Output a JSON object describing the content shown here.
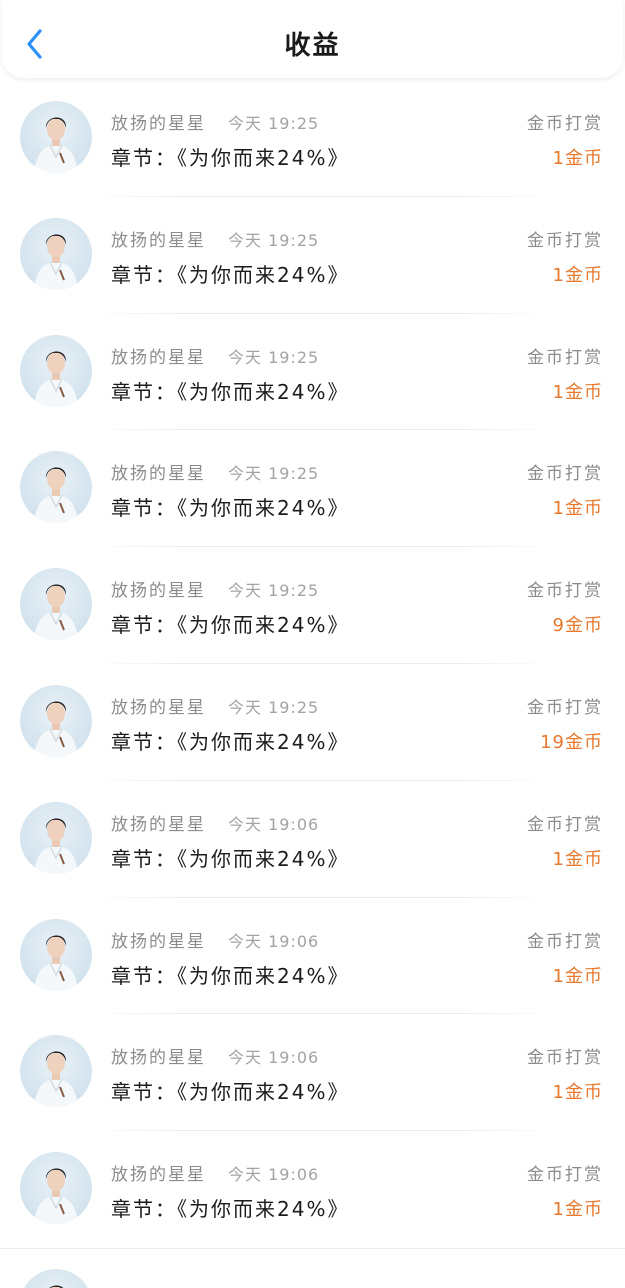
{
  "header": {
    "title": "收益",
    "back_icon": "chevron-left-icon",
    "accent_color": "#2b8ff5"
  },
  "colors": {
    "amount": "#e8782c",
    "secondary_text": "#8c8c8c",
    "primary_text": "#1c1c1c"
  },
  "records": [
    {
      "user": "放扬的星星",
      "time": "今天 19:25",
      "chapter": "章节：《为你而来24%》",
      "type": "金币打赏",
      "amount": "1金币"
    },
    {
      "user": "放扬的星星",
      "time": "今天 19:25",
      "chapter": "章节：《为你而来24%》",
      "type": "金币打赏",
      "amount": "1金币"
    },
    {
      "user": "放扬的星星",
      "time": "今天 19:25",
      "chapter": "章节：《为你而来24%》",
      "type": "金币打赏",
      "amount": "1金币"
    },
    {
      "user": "放扬的星星",
      "time": "今天 19:25",
      "chapter": "章节：《为你而来24%》",
      "type": "金币打赏",
      "amount": "1金币"
    },
    {
      "user": "放扬的星星",
      "time": "今天 19:25",
      "chapter": "章节：《为你而来24%》",
      "type": "金币打赏",
      "amount": "9金币"
    },
    {
      "user": "放扬的星星",
      "time": "今天 19:25",
      "chapter": "章节：《为你而来24%》",
      "type": "金币打赏",
      "amount": "19金币"
    },
    {
      "user": "放扬的星星",
      "time": "今天 19:06",
      "chapter": "章节：《为你而来24%》",
      "type": "金币打赏",
      "amount": "1金币"
    },
    {
      "user": "放扬的星星",
      "time": "今天 19:06",
      "chapter": "章节：《为你而来24%》",
      "type": "金币打赏",
      "amount": "1金币"
    },
    {
      "user": "放扬的星星",
      "time": "今天 19:06",
      "chapter": "章节：《为你而来24%》",
      "type": "金币打赏",
      "amount": "1金币"
    },
    {
      "user": "放扬的星星",
      "time": "今天 19:06",
      "chapter": "章节：《为你而来24%》",
      "type": "金币打赏",
      "amount": "1金币"
    }
  ]
}
